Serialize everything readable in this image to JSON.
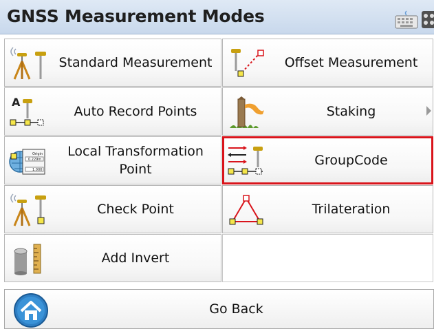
{
  "header": {
    "title": "GNSS Measurement Modes",
    "icons": [
      "keyboard-icon",
      "calculator-icon"
    ]
  },
  "tiles": [
    {
      "label": "Standard Measurement",
      "icon": "gnss-tripod-icon"
    },
    {
      "label": "Offset Measurement",
      "icon": "offset-measurement-icon"
    },
    {
      "label": "Auto Record Points",
      "icon": "auto-record-icon"
    },
    {
      "label": "Staking",
      "icon": "staking-stake-icon",
      "has_submenu": true
    },
    {
      "label": "Local Transformation Point",
      "icon": "transformation-icon"
    },
    {
      "label": "GroupCode",
      "icon": "groupcode-icon",
      "selected": true
    },
    {
      "label": "Check Point",
      "icon": "check-point-icon"
    },
    {
      "label": "Trilateration",
      "icon": "trilateration-icon"
    },
    {
      "label": "Add Invert",
      "icon": "add-invert-icon"
    }
  ],
  "footer": {
    "go_back_label": "Go Back",
    "icon": "home-icon"
  },
  "transformation_icon_text": [
    "Origin",
    "0.229m",
    "1.000"
  ],
  "auto_record_letter": "A",
  "colors": {
    "selection_border": "#d9141b",
    "header_bg": "#c8d8ec"
  }
}
